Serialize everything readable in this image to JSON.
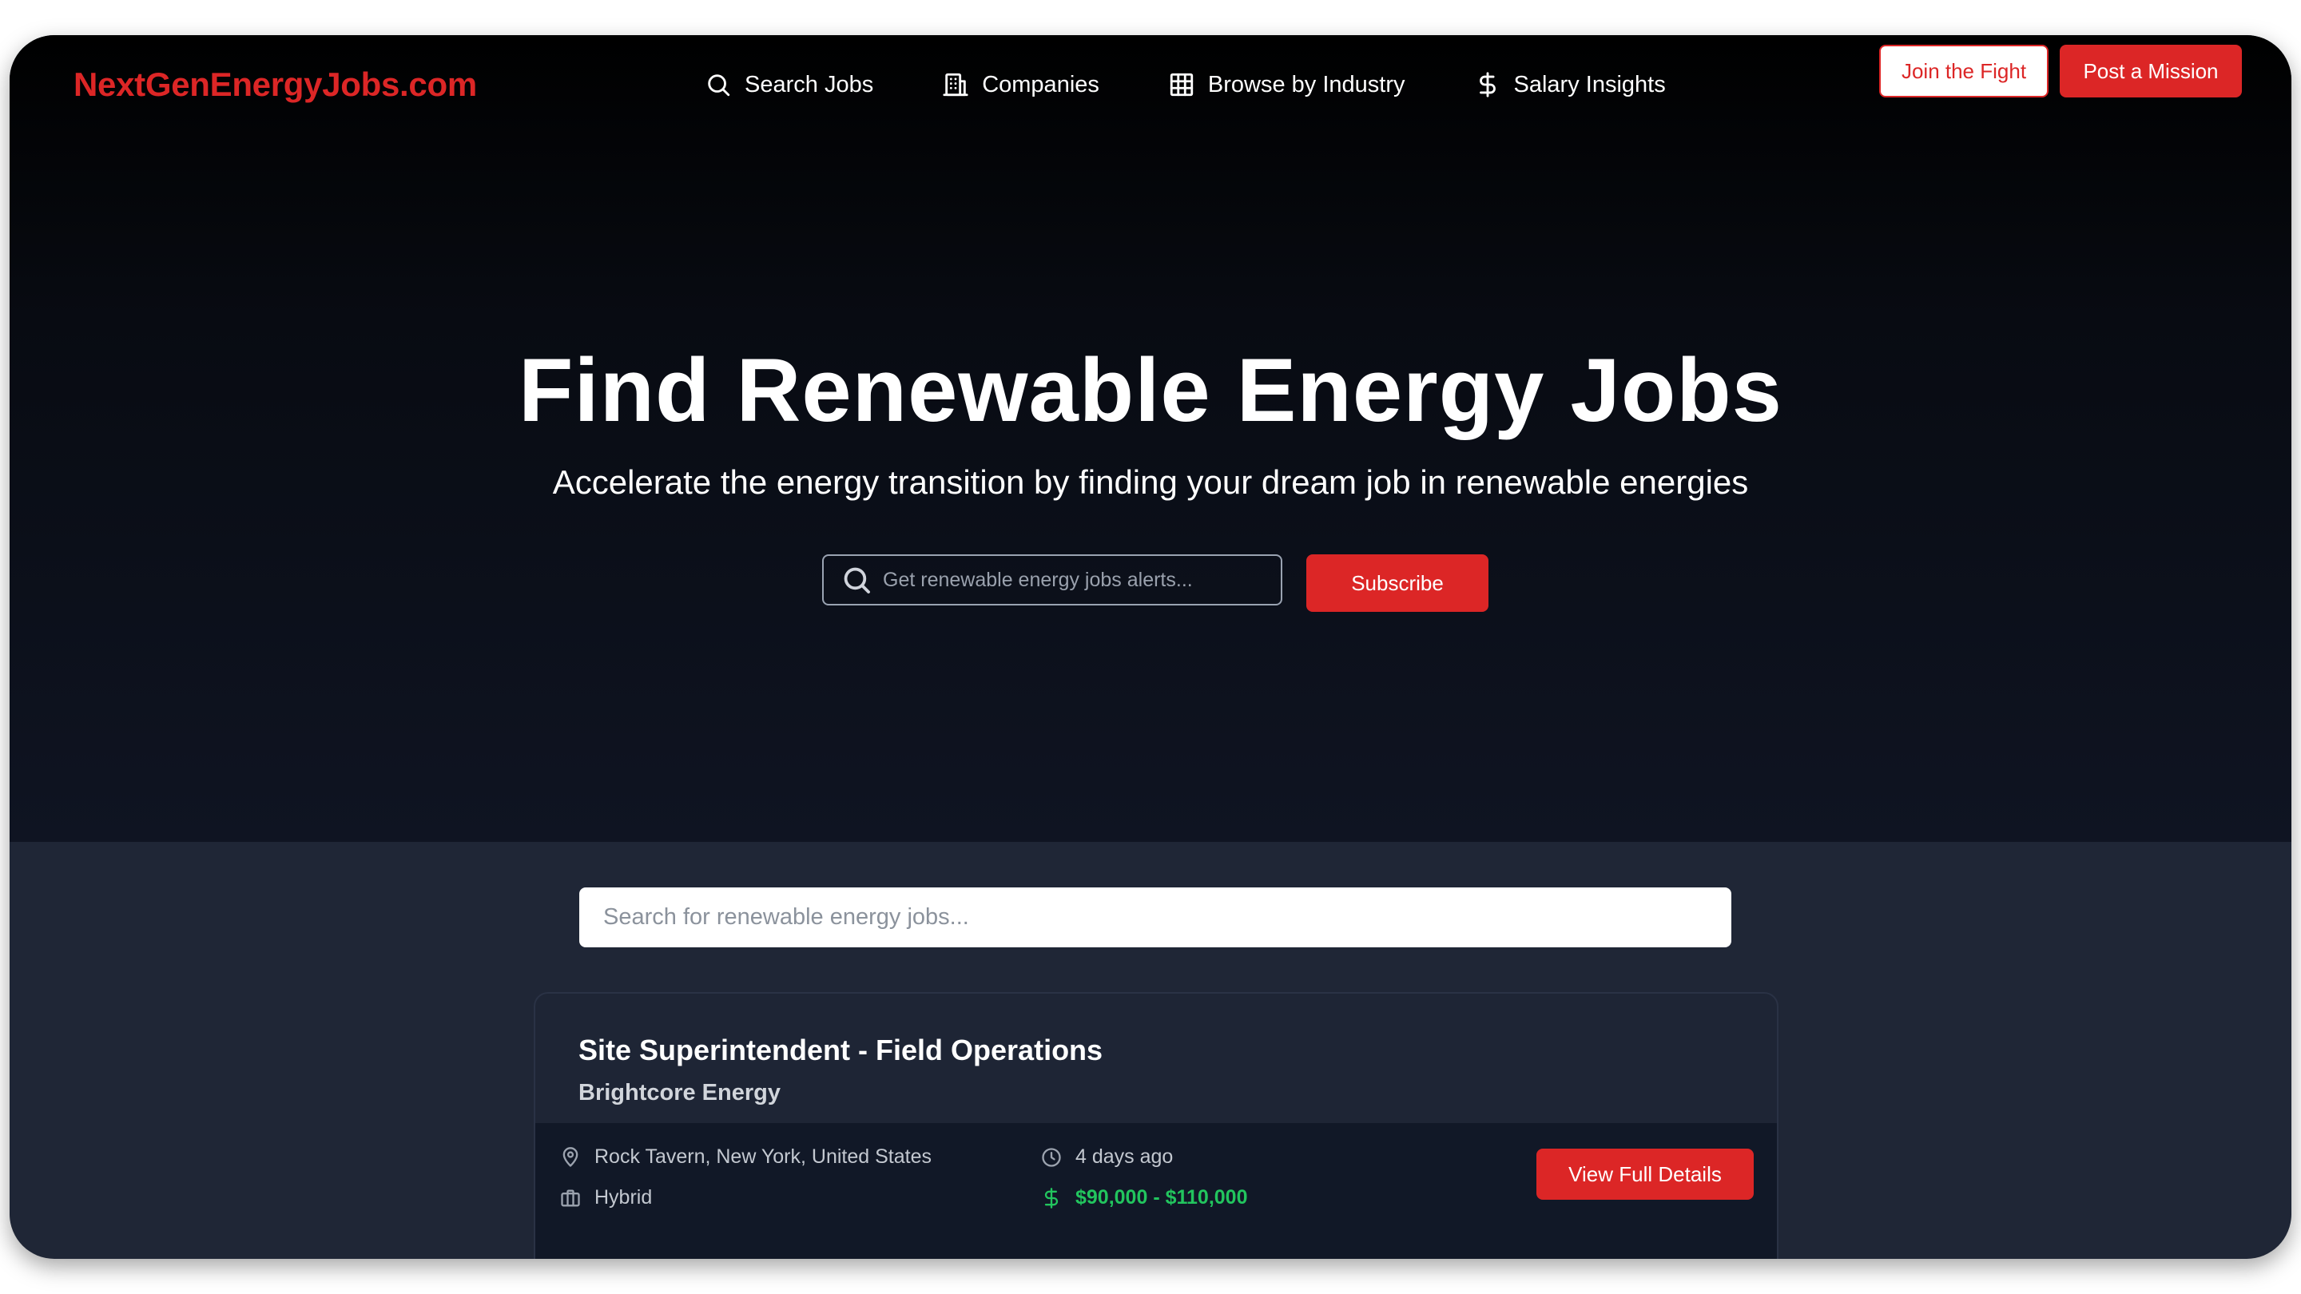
{
  "header": {
    "logo": "NextGenEnergyJobs.com",
    "nav": [
      {
        "label": "Search Jobs",
        "icon": "search-icon"
      },
      {
        "label": "Companies",
        "icon": "building-icon"
      },
      {
        "label": "Browse by Industry",
        "icon": "grid-icon"
      },
      {
        "label": "Salary Insights",
        "icon": "dollar-icon"
      }
    ],
    "join_label": "Join the Fight",
    "post_label": "Post a Mission"
  },
  "hero": {
    "title": "Find Renewable Energy Jobs",
    "subtitle": "Accelerate the energy transition by finding your dream job in renewable energies",
    "alert_placeholder": "Get renewable energy jobs alerts...",
    "subscribe_label": "Subscribe"
  },
  "search": {
    "placeholder": "Search for renewable energy jobs..."
  },
  "jobs": [
    {
      "title": "Site Superintendent - Field Operations",
      "company": "Brightcore Energy",
      "location": "Rock Tavern, New York, United States",
      "work_type": "Hybrid",
      "posted": "4 days ago",
      "salary": "$90,000 - $110,000",
      "details_label": "View Full Details"
    }
  ],
  "colors": {
    "accent": "#dc2626",
    "salary": "#22c55e",
    "hero_bg": "#000000",
    "section_bg": "#1f2636"
  }
}
